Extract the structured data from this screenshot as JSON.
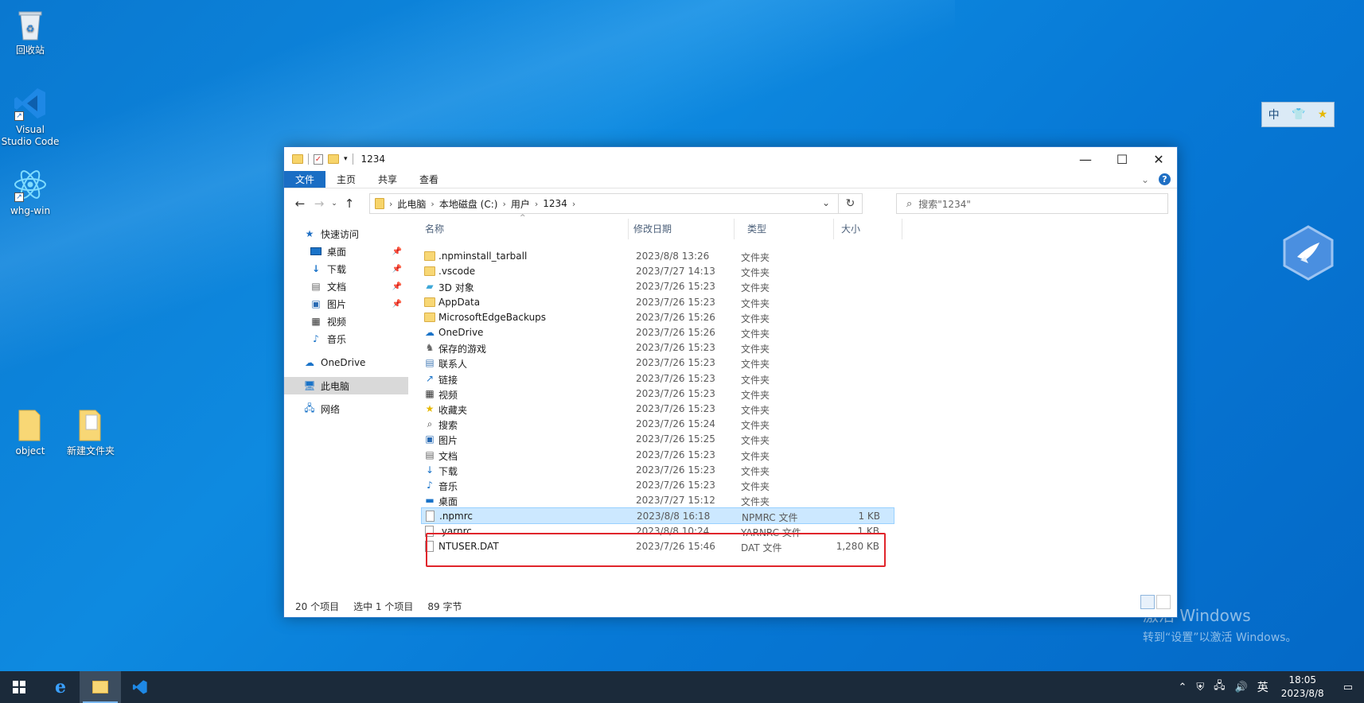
{
  "desktop": {
    "icons": [
      {
        "label": "回收站"
      },
      {
        "label": "Visual Studio Code"
      },
      {
        "label": "whg-win"
      },
      {
        "label": "object"
      },
      {
        "label": "新建文件夹"
      }
    ],
    "ime_bar": {
      "mode": "中"
    },
    "activation": {
      "title": "激活 Windows",
      "subtitle": "转到“设置”以激活 Windows。"
    }
  },
  "explorer": {
    "title": "1234",
    "ribbon_tabs": [
      "文件",
      "主页",
      "共享",
      "查看"
    ],
    "breadcrumb": [
      "此电脑",
      "本地磁盘 (C:)",
      "用户",
      "1234"
    ],
    "search_placeholder": "搜索\"1234\"",
    "nav_pane": {
      "quick_access": "快速访问",
      "quick_items": [
        "桌面",
        "下载",
        "文档",
        "图片",
        "视频",
        "音乐"
      ],
      "onedrive": "OneDrive",
      "this_pc": "此电脑",
      "network": "网络"
    },
    "columns": [
      "名称",
      "修改日期",
      "类型",
      "大小"
    ],
    "files": [
      {
        "name": ".npminstall_tarball",
        "date": "2023/8/8 13:26",
        "type": "文件夹",
        "size": "",
        "icon": "folder-icon"
      },
      {
        "name": ".vscode",
        "date": "2023/7/27 14:13",
        "type": "文件夹",
        "size": "",
        "icon": "folder-icon"
      },
      {
        "name": "3D 对象",
        "date": "2023/7/26 15:23",
        "type": "文件夹",
        "size": "",
        "icon": "3d-objects-icon"
      },
      {
        "name": "AppData",
        "date": "2023/7/26 15:23",
        "type": "文件夹",
        "size": "",
        "icon": "folder-icon"
      },
      {
        "name": "MicrosoftEdgeBackups",
        "date": "2023/7/26 15:26",
        "type": "文件夹",
        "size": "",
        "icon": "folder-icon"
      },
      {
        "name": "OneDrive",
        "date": "2023/7/26 15:26",
        "type": "文件夹",
        "size": "",
        "icon": "cloud-icon"
      },
      {
        "name": "保存的游戏",
        "date": "2023/7/26 15:23",
        "type": "文件夹",
        "size": "",
        "icon": "saved-games-icon"
      },
      {
        "name": "联系人",
        "date": "2023/7/26 15:23",
        "type": "文件夹",
        "size": "",
        "icon": "contacts-icon"
      },
      {
        "name": "链接",
        "date": "2023/7/26 15:23",
        "type": "文件夹",
        "size": "",
        "icon": "links-icon"
      },
      {
        "name": "视频",
        "date": "2023/7/26 15:23",
        "type": "文件夹",
        "size": "",
        "icon": "videos-icon"
      },
      {
        "name": "收藏夹",
        "date": "2023/7/26 15:23",
        "type": "文件夹",
        "size": "",
        "icon": "favorites-icon"
      },
      {
        "name": "搜索",
        "date": "2023/7/26 15:24",
        "type": "文件夹",
        "size": "",
        "icon": "search-icon"
      },
      {
        "name": "图片",
        "date": "2023/7/26 15:25",
        "type": "文件夹",
        "size": "",
        "icon": "pictures-icon"
      },
      {
        "name": "文档",
        "date": "2023/7/26 15:23",
        "type": "文件夹",
        "size": "",
        "icon": "documents-icon"
      },
      {
        "name": "下载",
        "date": "2023/7/26 15:23",
        "type": "文件夹",
        "size": "",
        "icon": "downloads-icon"
      },
      {
        "name": "音乐",
        "date": "2023/7/26 15:23",
        "type": "文件夹",
        "size": "",
        "icon": "music-icon"
      },
      {
        "name": "桌面",
        "date": "2023/7/27 15:12",
        "type": "文件夹",
        "size": "",
        "icon": "desktop-icon"
      },
      {
        "name": ".npmrc",
        "date": "2023/8/8 16:18",
        "type": "NPMRC 文件",
        "size": "1 KB",
        "icon": "file-icon",
        "selected": true
      },
      {
        "name": ".yarnrc",
        "date": "2023/8/8 10:24",
        "type": "YARNRC 文件",
        "size": "1 KB",
        "icon": "file-icon"
      },
      {
        "name": "NTUSER.DAT",
        "date": "2023/7/26 15:46",
        "type": "DAT 文件",
        "size": "1,280 KB",
        "icon": "file-icon"
      }
    ],
    "status": {
      "count": "20 个项目",
      "selection": "选中 1 个项目",
      "size": "89 字节"
    }
  },
  "taskbar": {
    "ime_lang": "英",
    "time": "18:05",
    "date": "2023/8/8"
  }
}
